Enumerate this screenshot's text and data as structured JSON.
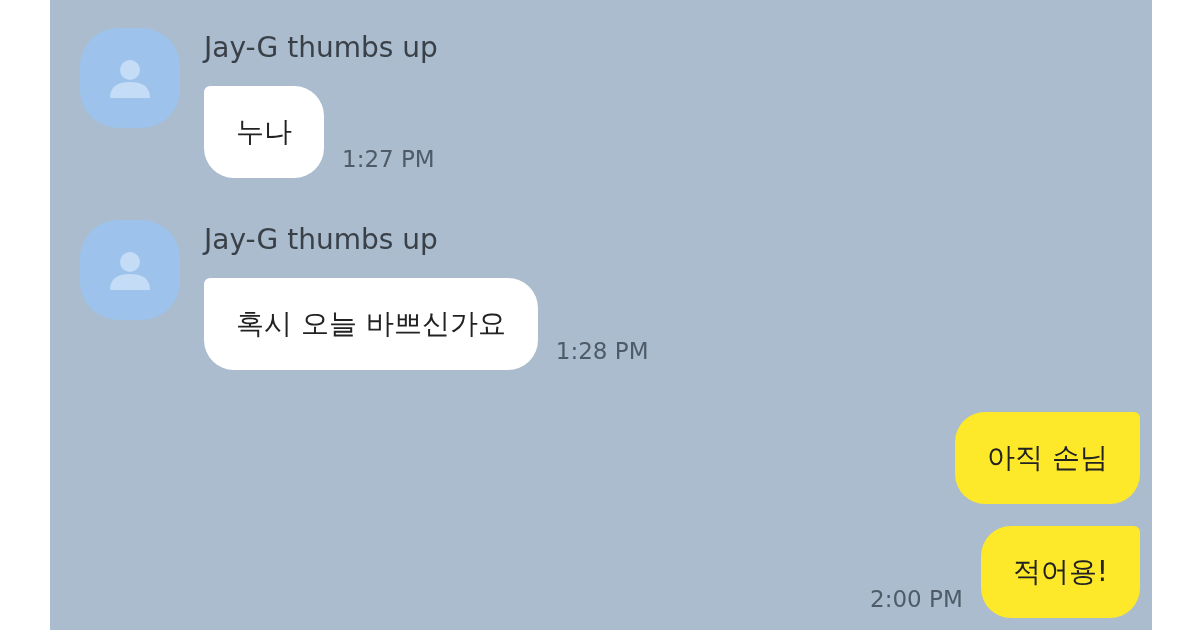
{
  "messages": [
    {
      "kind": "received",
      "sender": "Jay-G thumbs up",
      "text": "누나",
      "time": "1:27 PM"
    },
    {
      "kind": "received",
      "sender": "Jay-G thumbs up",
      "text": "혹시 오늘 바쁘신가요",
      "time": "1:28 PM"
    },
    {
      "kind": "sent",
      "text": "아직 손님"
    },
    {
      "kind": "sent",
      "text": "적어용!",
      "time": "2:00 PM"
    }
  ]
}
